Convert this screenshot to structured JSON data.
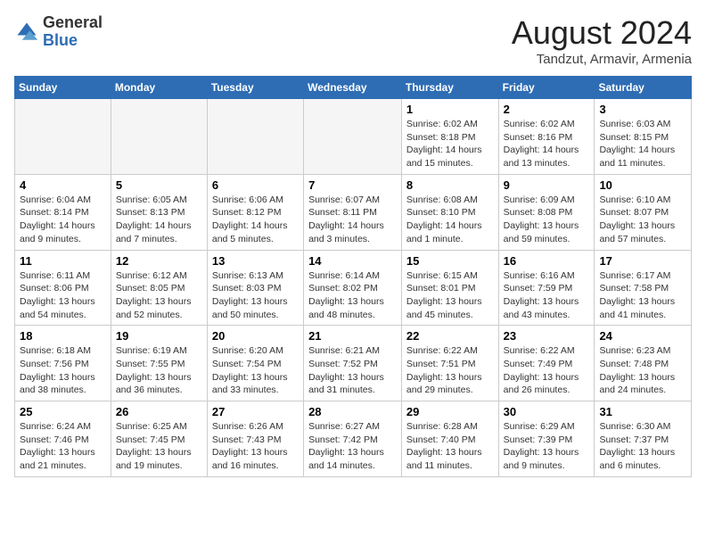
{
  "header": {
    "logo_line1": "General",
    "logo_line2": "Blue",
    "month_title": "August 2024",
    "location": "Tandzut, Armavir, Armenia"
  },
  "weekdays": [
    "Sunday",
    "Monday",
    "Tuesday",
    "Wednesday",
    "Thursday",
    "Friday",
    "Saturday"
  ],
  "weeks": [
    [
      {
        "day": "",
        "info": ""
      },
      {
        "day": "",
        "info": ""
      },
      {
        "day": "",
        "info": ""
      },
      {
        "day": "",
        "info": ""
      },
      {
        "day": "1",
        "info": "Sunrise: 6:02 AM\nSunset: 8:18 PM\nDaylight: 14 hours\nand 15 minutes."
      },
      {
        "day": "2",
        "info": "Sunrise: 6:02 AM\nSunset: 8:16 PM\nDaylight: 14 hours\nand 13 minutes."
      },
      {
        "day": "3",
        "info": "Sunrise: 6:03 AM\nSunset: 8:15 PM\nDaylight: 14 hours\nand 11 minutes."
      }
    ],
    [
      {
        "day": "4",
        "info": "Sunrise: 6:04 AM\nSunset: 8:14 PM\nDaylight: 14 hours\nand 9 minutes."
      },
      {
        "day": "5",
        "info": "Sunrise: 6:05 AM\nSunset: 8:13 PM\nDaylight: 14 hours\nand 7 minutes."
      },
      {
        "day": "6",
        "info": "Sunrise: 6:06 AM\nSunset: 8:12 PM\nDaylight: 14 hours\nand 5 minutes."
      },
      {
        "day": "7",
        "info": "Sunrise: 6:07 AM\nSunset: 8:11 PM\nDaylight: 14 hours\nand 3 minutes."
      },
      {
        "day": "8",
        "info": "Sunrise: 6:08 AM\nSunset: 8:10 PM\nDaylight: 14 hours\nand 1 minute."
      },
      {
        "day": "9",
        "info": "Sunrise: 6:09 AM\nSunset: 8:08 PM\nDaylight: 13 hours\nand 59 minutes."
      },
      {
        "day": "10",
        "info": "Sunrise: 6:10 AM\nSunset: 8:07 PM\nDaylight: 13 hours\nand 57 minutes."
      }
    ],
    [
      {
        "day": "11",
        "info": "Sunrise: 6:11 AM\nSunset: 8:06 PM\nDaylight: 13 hours\nand 54 minutes."
      },
      {
        "day": "12",
        "info": "Sunrise: 6:12 AM\nSunset: 8:05 PM\nDaylight: 13 hours\nand 52 minutes."
      },
      {
        "day": "13",
        "info": "Sunrise: 6:13 AM\nSunset: 8:03 PM\nDaylight: 13 hours\nand 50 minutes."
      },
      {
        "day": "14",
        "info": "Sunrise: 6:14 AM\nSunset: 8:02 PM\nDaylight: 13 hours\nand 48 minutes."
      },
      {
        "day": "15",
        "info": "Sunrise: 6:15 AM\nSunset: 8:01 PM\nDaylight: 13 hours\nand 45 minutes."
      },
      {
        "day": "16",
        "info": "Sunrise: 6:16 AM\nSunset: 7:59 PM\nDaylight: 13 hours\nand 43 minutes."
      },
      {
        "day": "17",
        "info": "Sunrise: 6:17 AM\nSunset: 7:58 PM\nDaylight: 13 hours\nand 41 minutes."
      }
    ],
    [
      {
        "day": "18",
        "info": "Sunrise: 6:18 AM\nSunset: 7:56 PM\nDaylight: 13 hours\nand 38 minutes."
      },
      {
        "day": "19",
        "info": "Sunrise: 6:19 AM\nSunset: 7:55 PM\nDaylight: 13 hours\nand 36 minutes."
      },
      {
        "day": "20",
        "info": "Sunrise: 6:20 AM\nSunset: 7:54 PM\nDaylight: 13 hours\nand 33 minutes."
      },
      {
        "day": "21",
        "info": "Sunrise: 6:21 AM\nSunset: 7:52 PM\nDaylight: 13 hours\nand 31 minutes."
      },
      {
        "day": "22",
        "info": "Sunrise: 6:22 AM\nSunset: 7:51 PM\nDaylight: 13 hours\nand 29 minutes."
      },
      {
        "day": "23",
        "info": "Sunrise: 6:22 AM\nSunset: 7:49 PM\nDaylight: 13 hours\nand 26 minutes."
      },
      {
        "day": "24",
        "info": "Sunrise: 6:23 AM\nSunset: 7:48 PM\nDaylight: 13 hours\nand 24 minutes."
      }
    ],
    [
      {
        "day": "25",
        "info": "Sunrise: 6:24 AM\nSunset: 7:46 PM\nDaylight: 13 hours\nand 21 minutes."
      },
      {
        "day": "26",
        "info": "Sunrise: 6:25 AM\nSunset: 7:45 PM\nDaylight: 13 hours\nand 19 minutes."
      },
      {
        "day": "27",
        "info": "Sunrise: 6:26 AM\nSunset: 7:43 PM\nDaylight: 13 hours\nand 16 minutes."
      },
      {
        "day": "28",
        "info": "Sunrise: 6:27 AM\nSunset: 7:42 PM\nDaylight: 13 hours\nand 14 minutes."
      },
      {
        "day": "29",
        "info": "Sunrise: 6:28 AM\nSunset: 7:40 PM\nDaylight: 13 hours\nand 11 minutes."
      },
      {
        "day": "30",
        "info": "Sunrise: 6:29 AM\nSunset: 7:39 PM\nDaylight: 13 hours\nand 9 minutes."
      },
      {
        "day": "31",
        "info": "Sunrise: 6:30 AM\nSunset: 7:37 PM\nDaylight: 13 hours\nand 6 minutes."
      }
    ]
  ]
}
